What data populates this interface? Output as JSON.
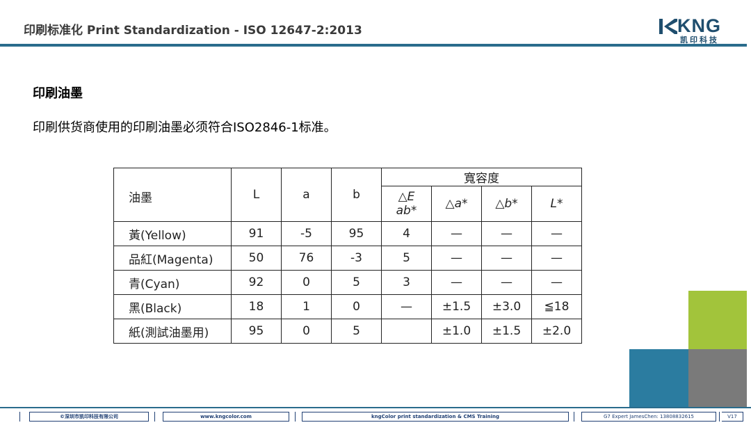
{
  "header": {
    "title": "印刷标准化 Print Standardization - ISO 12647-2:2013",
    "logo_text": "KNG",
    "logo_sub": "凯印科技"
  },
  "section": {
    "title": "印刷油墨",
    "body": "印刷供货商使用的印刷油墨必须符合ISO2846-1标准。"
  },
  "table": {
    "header_ink": "油墨",
    "header_L": "L",
    "header_a": "a",
    "header_b": "b",
    "header_tolerance": "寬容度",
    "header_dE_1": "△E",
    "header_dE_2": "ab*",
    "header_da": "△a*",
    "header_db": "△b*",
    "header_dL": "L*",
    "rows": [
      {
        "ink": "黃(Yellow)",
        "L": "91",
        "a": "-5",
        "b": "95",
        "dE": "4",
        "da": "—",
        "db": "—",
        "dL": "—"
      },
      {
        "ink": "品紅(Magenta)",
        "L": "50",
        "a": "76",
        "b": "-3",
        "dE": "5",
        "da": "—",
        "db": "—",
        "dL": "—"
      },
      {
        "ink": "青(Cyan)",
        "L": "92",
        "a": "0",
        "b": "5",
        "dE": "3",
        "da": "—",
        "db": "—",
        "dL": "—"
      },
      {
        "ink": "黑(Black)",
        "L": "18",
        "a": "1",
        "b": "0",
        "dE": "—",
        "da": "±1.5",
        "db": "±3.0",
        "dL": "≦18"
      },
      {
        "ink": "紙(測試油墨用)",
        "L": "95",
        "a": "0",
        "b": "5",
        "dE": "",
        "da": "±1.0",
        "db": "±1.5",
        "dL": "±2.0"
      }
    ]
  },
  "footer": {
    "company": "©深圳市凯印科技有限公司",
    "website": "www.kngcolor.com",
    "training": "kngColor print standardization & CMS Training",
    "contact": "G7 Expert JamesChen: 13808832615",
    "version": "V17"
  },
  "colors": {
    "accent_blue": "#2a6c8c",
    "square_green": "#a2c43b",
    "square_teal": "#2b7ca0",
    "square_gray": "#7a7a7a"
  }
}
